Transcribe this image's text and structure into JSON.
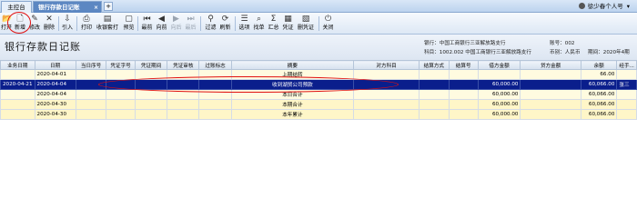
{
  "tabs": {
    "home": "主控台",
    "active": "银行存款日记账",
    "close": "×",
    "add": "+"
  },
  "user": {
    "name": "徐少春个人号",
    "chevron": "▾"
  },
  "toolbar": {
    "items": [
      {
        "label": "打开",
        "icon": "folder-icon",
        "glyph": "📂"
      },
      {
        "label": "新增",
        "icon": "new-doc-icon",
        "glyph": "🗋"
      },
      {
        "label": "修改",
        "icon": "edit-icon",
        "glyph": "✎"
      },
      {
        "label": "删除",
        "icon": "delete-icon",
        "glyph": "✕"
      },
      {
        "label": "引入",
        "icon": "import-icon",
        "glyph": "⇩"
      },
      {
        "label": "打印",
        "icon": "print-icon",
        "glyph": "⎙"
      },
      {
        "label": "收银套打",
        "icon": "cash-print-icon",
        "glyph": "▤"
      },
      {
        "label": "预览",
        "icon": "preview-icon",
        "glyph": "▢"
      },
      {
        "label": "最前",
        "icon": "first-icon",
        "glyph": "⏮"
      },
      {
        "label": "向前",
        "icon": "prev-icon",
        "glyph": "◀"
      },
      {
        "label": "向后",
        "icon": "next-icon",
        "glyph": "▶"
      },
      {
        "label": "最后",
        "icon": "last-icon",
        "glyph": "⏭"
      },
      {
        "label": "过滤",
        "icon": "filter-icon",
        "glyph": "⚲"
      },
      {
        "label": "刷新",
        "icon": "refresh-icon",
        "glyph": "⟳"
      },
      {
        "label": "选项",
        "icon": "options-icon",
        "glyph": "☰"
      },
      {
        "label": "找单",
        "icon": "find-doc-icon",
        "glyph": "⌕"
      },
      {
        "label": "汇总",
        "icon": "summary-icon",
        "glyph": "Σ"
      },
      {
        "label": "凭证",
        "icon": "voucher-icon",
        "glyph": "▦"
      },
      {
        "label": "删凭证",
        "icon": "delete-voucher-icon",
        "glyph": "▧"
      },
      {
        "label": "关闭",
        "icon": "close-icon",
        "glyph": "⏻"
      }
    ]
  },
  "header": {
    "title": "银行存款日记账",
    "bank_label": "银行：",
    "bank_value": "中国工商银行三亚解放路支行",
    "subject_label": "科目：",
    "subject_value": "1002.002 中国工商银行三亚解放路支行",
    "account_label": "账号：",
    "account_value": "002",
    "currency_label": "币别：",
    "currency_value": "人民币",
    "period_label": "期间：",
    "period_value": "2020年4期"
  },
  "table": {
    "columns": [
      "业务日期",
      "日期",
      "当日序号",
      "凭证字号",
      "凭证期间",
      "凭证审核",
      "过账标志",
      "摘要",
      "对方科目",
      "结算方式",
      "结算号",
      "借方金额",
      "贷方金额",
      "余额",
      "经手..."
    ],
    "rows": [
      {
        "type": "plain",
        "cells": [
          "",
          "2020-04-01",
          "",
          "",
          "",
          "",
          "",
          "上期结转",
          "",
          "",
          "",
          "",
          "",
          "66.00",
          ""
        ]
      },
      {
        "type": "selected",
        "cells": [
          "2020-04-21",
          "2020-04-04",
          "",
          "",
          "",
          "",
          "",
          "收到湖贸公司预款",
          "",
          "",
          "",
          "60,000.00",
          "",
          "60,066.00",
          "张三"
        ]
      },
      {
        "type": "summary",
        "cells": [
          "",
          "2020-04-04",
          "",
          "",
          "",
          "",
          "",
          "本日合计",
          "",
          "",
          "",
          "60,000.00",
          "",
          "60,066.00",
          ""
        ]
      },
      {
        "type": "sub",
        "cells": [
          "",
          "2020-04-30",
          "",
          "",
          "",
          "",
          "",
          "本期合计",
          "",
          "",
          "",
          "60,000.00",
          "",
          "60,066.00",
          ""
        ]
      },
      {
        "type": "sub",
        "cells": [
          "",
          "2020-04-30",
          "",
          "",
          "",
          "",
          "",
          "本年累计",
          "",
          "",
          "",
          "60,000.00",
          "",
          "60,066.00",
          ""
        ]
      }
    ]
  }
}
